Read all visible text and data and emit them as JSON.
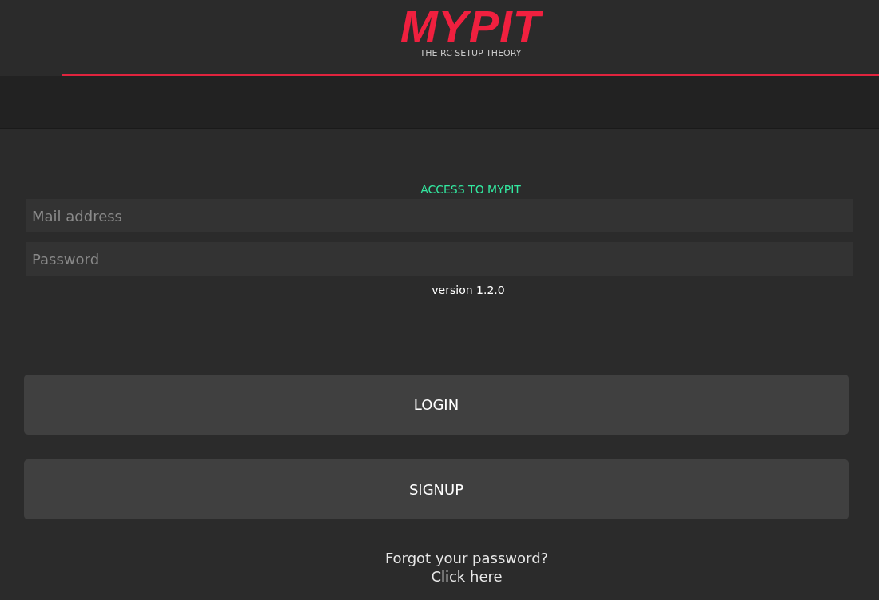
{
  "header": {
    "logo": "MYPIT",
    "tagline": "THE RC SETUP THEORY"
  },
  "login": {
    "heading": "ACCESS TO MYPIT",
    "fields": [
      {
        "placeholder": "Mail address"
      },
      {
        "placeholder": "Password"
      }
    ],
    "version": "version 1.2.0",
    "buttons": [
      "LOGIN",
      "SIGNUP"
    ],
    "forgot": "Forgot your password?",
    "link": "Click here"
  }
}
